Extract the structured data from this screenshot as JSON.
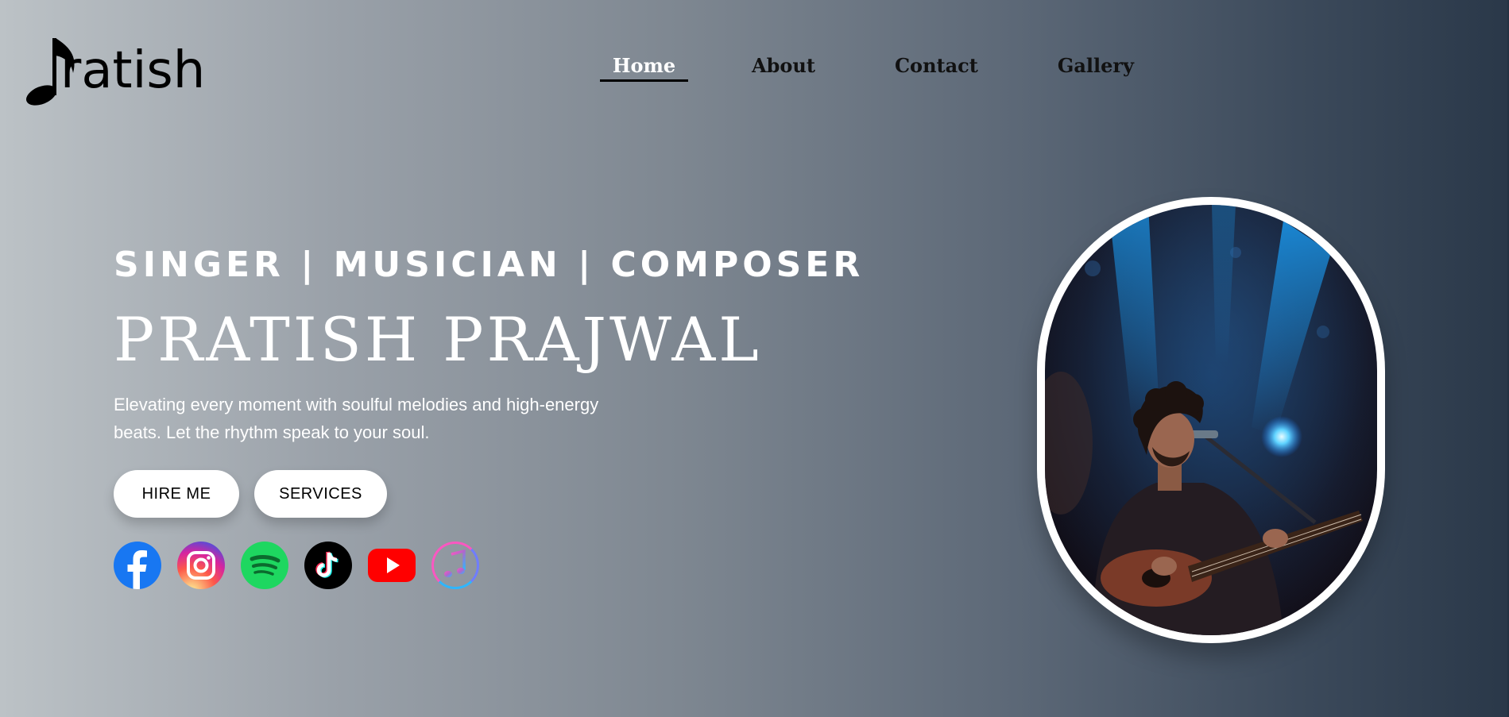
{
  "brand": {
    "logo_text": "ratish"
  },
  "nav": {
    "items": [
      {
        "label": "Home",
        "active": true
      },
      {
        "label": "About"
      },
      {
        "label": "Contact"
      },
      {
        "label": "Gallery"
      }
    ]
  },
  "hero": {
    "tagline": "SINGER | MUSICIAN | COMPOSER",
    "name": "PRATISH PRAJWAL",
    "description": "Elevating every moment with soulful melodies and high-energy beats. Let the rhythm speak to your soul.",
    "buttons": {
      "hire": "HIRE ME",
      "services": "SERVICES"
    }
  },
  "socials": [
    {
      "icon": "facebook-icon",
      "color": "#1877f2"
    },
    {
      "icon": "instagram-icon",
      "color": "#d6249f"
    },
    {
      "icon": "spotify-icon",
      "color": "#1ed760"
    },
    {
      "icon": "tiktok-icon",
      "color": "#000000"
    },
    {
      "icon": "youtube-icon",
      "color": "#ff0000"
    },
    {
      "icon": "apple-music-icon",
      "color": "#fa57c1"
    }
  ],
  "colors": {
    "background_start": "#bcc2c6",
    "background_end": "#2a3849",
    "text_primary": "#ffffff",
    "nav_text": "#111111"
  },
  "photo": {
    "icon": "singer-photo"
  }
}
